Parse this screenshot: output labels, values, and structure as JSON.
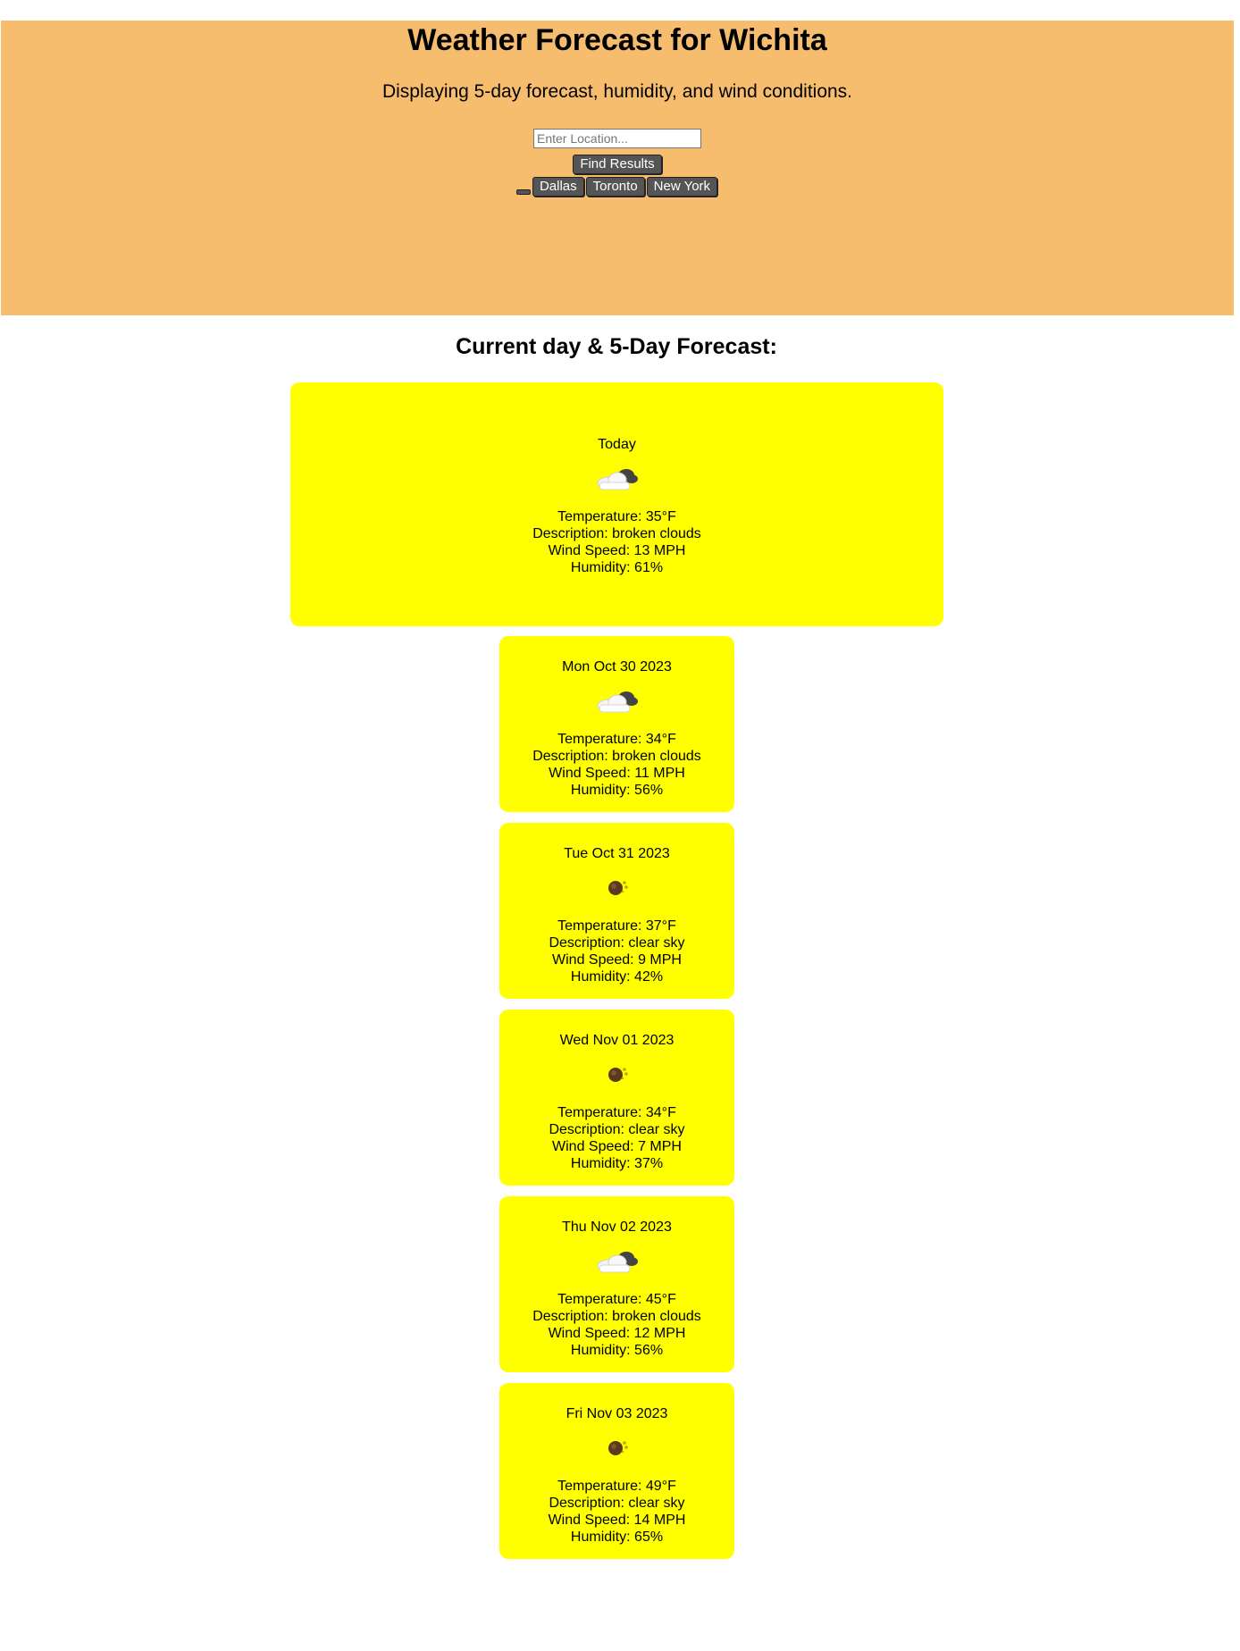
{
  "header": {
    "title": "Weather Forecast for Wichita",
    "subtitle": "Displaying 5-day forecast, humidity, and wind conditions.",
    "search_placeholder": "Enter Location...",
    "find_button": "Find Results",
    "cities": [
      "Dallas",
      "Toronto",
      "New York"
    ]
  },
  "forecast_title": "Current day & 5-Day Forecast:",
  "today": {
    "date": "Today",
    "icon": "broken-clouds-icon",
    "temperature": "Temperature: 35°F",
    "description": "Description: broken clouds",
    "wind": "Wind Speed: 13 MPH",
    "humidity": "Humidity: 61%"
  },
  "days": [
    {
      "date": "Mon Oct 30 2023",
      "icon": "broken-clouds-icon",
      "temperature": "Temperature: 34°F",
      "description": "Description: broken clouds",
      "wind": "Wind Speed: 11 MPH",
      "humidity": "Humidity: 56%"
    },
    {
      "date": "Tue Oct 31 2023",
      "icon": "clear-sky-icon",
      "temperature": "Temperature: 37°F",
      "description": "Description: clear sky",
      "wind": "Wind Speed: 9 MPH",
      "humidity": "Humidity: 42%"
    },
    {
      "date": "Wed Nov 01 2023",
      "icon": "clear-sky-icon",
      "temperature": "Temperature: 34°F",
      "description": "Description: clear sky",
      "wind": "Wind Speed: 7 MPH",
      "humidity": "Humidity: 37%"
    },
    {
      "date": "Thu Nov 02 2023",
      "icon": "broken-clouds-icon",
      "temperature": "Temperature: 45°F",
      "description": "Description: broken clouds",
      "wind": "Wind Speed: 12 MPH",
      "humidity": "Humidity: 56%"
    },
    {
      "date": "Fri Nov 03 2023",
      "icon": "clear-sky-icon",
      "temperature": "Temperature: 49°F",
      "description": "Description: clear sky",
      "wind": "Wind Speed: 14 MPH",
      "humidity": "Humidity: 65%"
    }
  ],
  "colors": {
    "header_bg": "#f6bd6e",
    "card_bg": "#ffff00",
    "button_bg": "#555555"
  }
}
